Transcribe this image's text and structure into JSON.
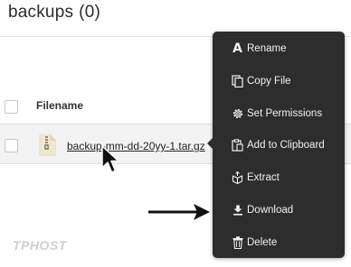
{
  "page": {
    "title": "backups",
    "count": "(0)"
  },
  "table": {
    "filename_header": "Filename"
  },
  "file": {
    "name": "backup-mm-dd-20yy-1.tar.gz"
  },
  "context_menu": {
    "items": [
      {
        "label": "Rename",
        "icon": "text-a-icon"
      },
      {
        "label": "Copy File",
        "icon": "copy-icon"
      },
      {
        "label": "Set Permissions",
        "icon": "gear-icon"
      },
      {
        "label": "Add to Clipboard",
        "icon": "clipboard-icon"
      },
      {
        "label": "Extract",
        "icon": "box-open-icon"
      },
      {
        "label": "Download",
        "icon": "download-icon"
      },
      {
        "label": "Delete",
        "icon": "trash-icon"
      }
    ]
  },
  "watermark": "TPHOST",
  "colors": {
    "menu_background": "#2d2d2d",
    "menu_text": "#f2f2f2",
    "row_highlight": "#f3f3f3"
  }
}
